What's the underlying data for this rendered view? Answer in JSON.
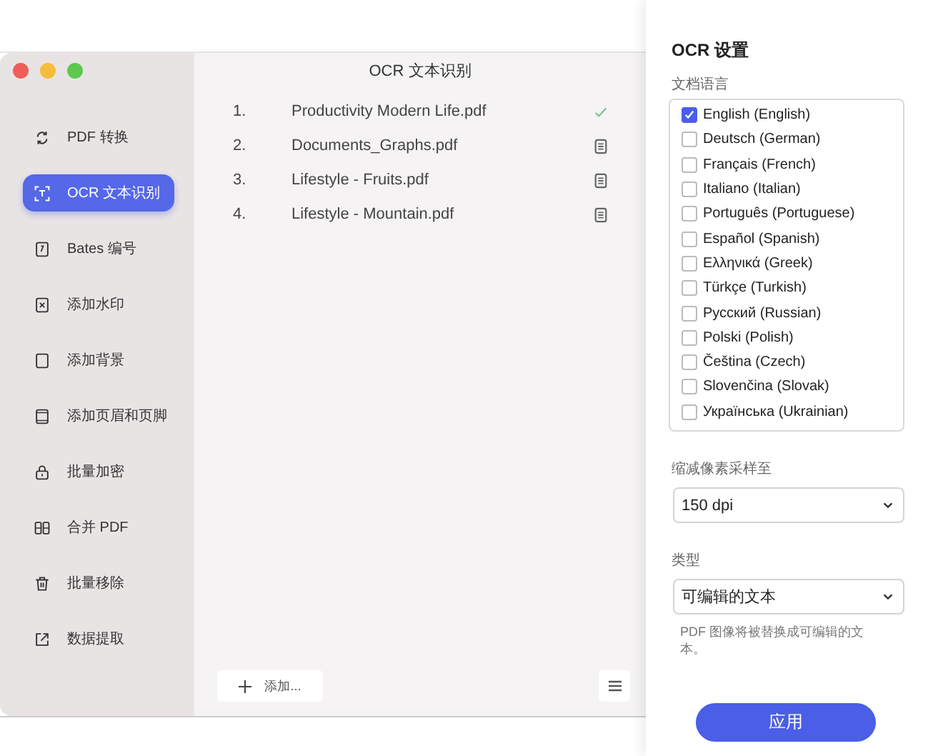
{
  "window": {
    "title": "OCR 文本识别"
  },
  "sidebar": {
    "items": [
      {
        "label": "PDF 转换",
        "selected": false
      },
      {
        "label": "OCR 文本识别",
        "selected": true
      },
      {
        "label": "Bates 编号",
        "selected": false
      },
      {
        "label": "添加水印",
        "selected": false
      },
      {
        "label": "添加背景",
        "selected": false
      },
      {
        "label": "添加页眉和页脚",
        "selected": false
      },
      {
        "label": "批量加密",
        "selected": false
      },
      {
        "label": "合并 PDF",
        "selected": false
      },
      {
        "label": "批量移除",
        "selected": false
      },
      {
        "label": "数据提取",
        "selected": false
      }
    ]
  },
  "files": [
    {
      "number": "1.",
      "name": "Productivity Modern Life.pdf",
      "kind": "done"
    },
    {
      "number": "2.",
      "name": "Documents_Graphs.pdf",
      "kind": "pending"
    },
    {
      "number": "3.",
      "name": "Lifestyle - Fruits.pdf",
      "kind": "pending"
    },
    {
      "number": "4.",
      "name": "Lifestyle - Mountain.pdf",
      "kind": "pending"
    }
  ],
  "add_button": {
    "label": "添加..."
  },
  "settings": {
    "title": "OCR 设置",
    "language_label": "文档语言",
    "languages": [
      {
        "label": "English (English)",
        "checked": true
      },
      {
        "label": "Deutsch (German)",
        "checked": false
      },
      {
        "label": "Français (French)",
        "checked": false
      },
      {
        "label": "Italiano (Italian)",
        "checked": false
      },
      {
        "label": "Português (Portuguese)",
        "checked": false
      },
      {
        "label": "Español (Spanish)",
        "checked": false
      },
      {
        "label": "Ελληνικά (Greek)",
        "checked": false
      },
      {
        "label": "Türkçe (Turkish)",
        "checked": false
      },
      {
        "label": "Русский (Russian)",
        "checked": false
      },
      {
        "label": "Polski (Polish)",
        "checked": false
      },
      {
        "label": "Čeština (Czech)",
        "checked": false
      },
      {
        "label": "Slovenčina (Slovak)",
        "checked": false
      },
      {
        "label": "Українська (Ukrainian)",
        "checked": false
      }
    ],
    "downsample_label": "缩减像素采样至",
    "downsample_value": "150 dpi",
    "type_label": "类型",
    "type_value": "可编辑的文本",
    "type_hint": "PDF 图像将被替换成可编辑的文本。",
    "apply_button": "应用"
  }
}
